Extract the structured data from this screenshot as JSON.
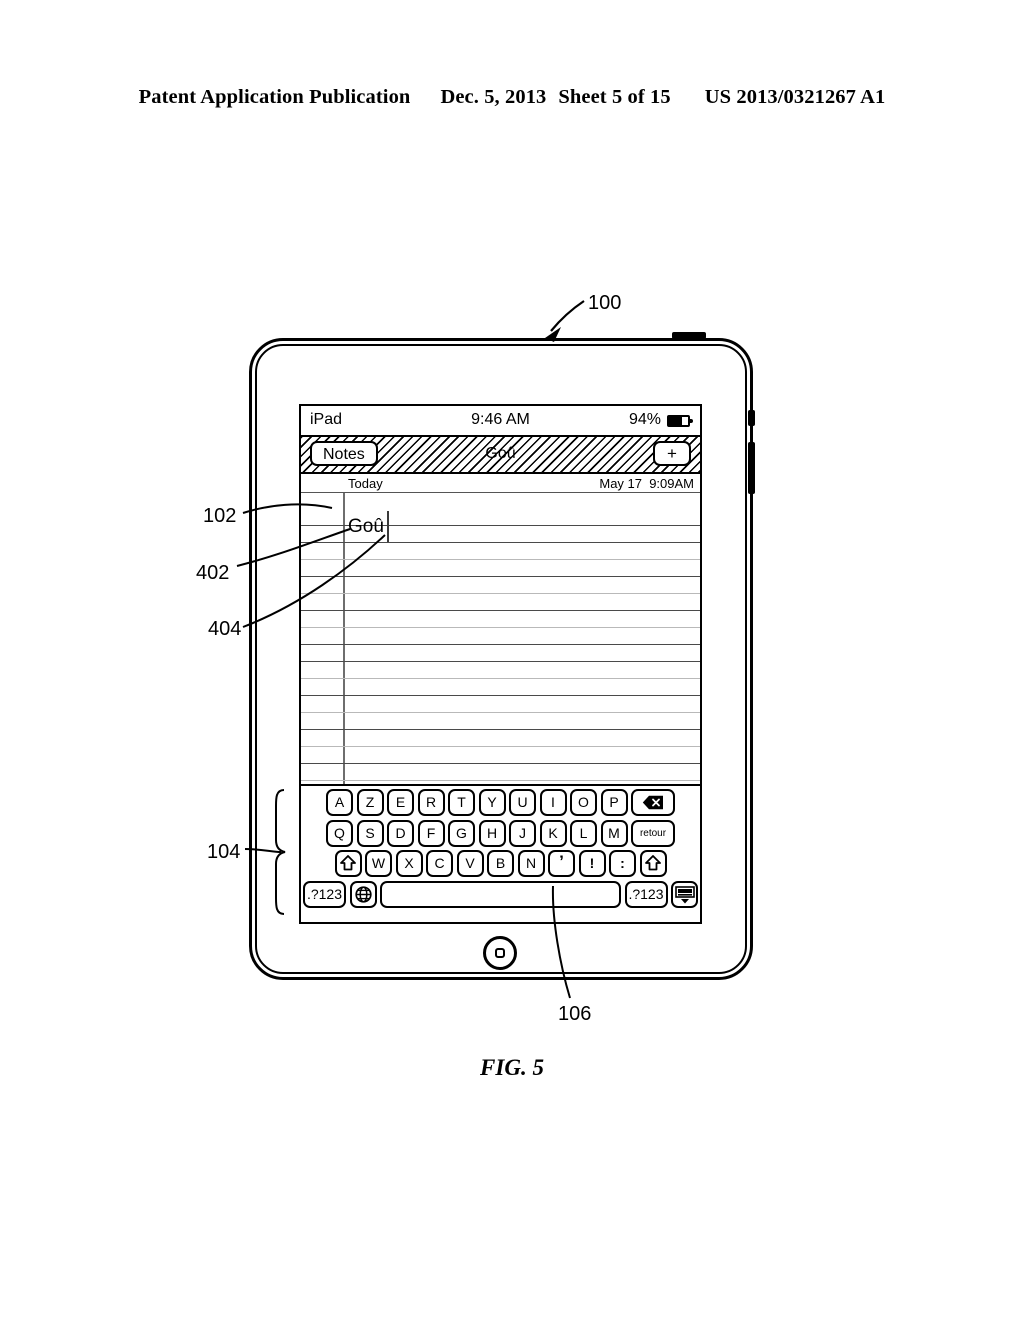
{
  "patent_header": {
    "publication": "Patent Application Publication",
    "date": "Dec. 5, 2013",
    "sheet": "Sheet 5 of 15",
    "number": "US 2013/0321267 A1"
  },
  "figure": {
    "caption": "FIG. 5"
  },
  "reference_numerals": {
    "device": "100",
    "display": "102",
    "keyboard": "104",
    "apostrophe_key": "106",
    "note_text_ref": "402",
    "caret_ref": "404"
  },
  "device": {
    "status_bar": {
      "device_name": "iPad",
      "time": "9:46 AM",
      "battery_percent": "94%",
      "battery_icon": "battery-icon"
    },
    "nav_bar": {
      "back_label": "Notes",
      "title": "Goû",
      "add_label": "+"
    },
    "note": {
      "day_label": "Today",
      "date": "May 17",
      "time": "9:09AM",
      "body_text": "Goû"
    },
    "keyboard": {
      "layout_name": "AZERTY",
      "rows": [
        [
          {
            "label": "A",
            "name": "key-a"
          },
          {
            "label": "Z",
            "name": "key-z"
          },
          {
            "label": "E",
            "name": "key-e"
          },
          {
            "label": "R",
            "name": "key-r"
          },
          {
            "label": "T",
            "name": "key-t"
          },
          {
            "label": "Y",
            "name": "key-y"
          },
          {
            "label": "U",
            "name": "key-u"
          },
          {
            "label": "I",
            "name": "key-i"
          },
          {
            "label": "O",
            "name": "key-o"
          },
          {
            "label": "P",
            "name": "key-p"
          },
          {
            "label": "",
            "name": "key-backspace",
            "icon": "backspace-icon"
          }
        ],
        [
          {
            "label": "Q",
            "name": "key-q"
          },
          {
            "label": "S",
            "name": "key-s"
          },
          {
            "label": "D",
            "name": "key-d"
          },
          {
            "label": "F",
            "name": "key-f"
          },
          {
            "label": "G",
            "name": "key-g"
          },
          {
            "label": "H",
            "name": "key-h"
          },
          {
            "label": "J",
            "name": "key-j"
          },
          {
            "label": "K",
            "name": "key-k"
          },
          {
            "label": "L",
            "name": "key-l"
          },
          {
            "label": "M",
            "name": "key-m"
          },
          {
            "label": "retour",
            "name": "key-return"
          }
        ],
        [
          {
            "label": "",
            "name": "key-shift-left",
            "icon": "shift-icon"
          },
          {
            "label": "W",
            "name": "key-w"
          },
          {
            "label": "X",
            "name": "key-x"
          },
          {
            "label": "C",
            "name": "key-c"
          },
          {
            "label": "V",
            "name": "key-v"
          },
          {
            "label": "B",
            "name": "key-b"
          },
          {
            "label": "N",
            "name": "key-n"
          },
          {
            "label": "’",
            "name": "key-apostrophe"
          },
          {
            "label": "!",
            "name": "key-exclamation"
          },
          {
            "label": ":",
            "name": "key-colon"
          },
          {
            "label": "",
            "name": "key-shift-right",
            "icon": "shift-icon"
          }
        ],
        [
          {
            "label": ".?123",
            "name": "key-numbers-left"
          },
          {
            "label": "",
            "name": "key-globe",
            "icon": "globe-icon"
          },
          {
            "label": "",
            "name": "key-space"
          },
          {
            "label": ".?123",
            "name": "key-numbers-right"
          },
          {
            "label": "",
            "name": "key-dismiss-keyboard",
            "icon": "keyboard-dismiss-icon"
          }
        ]
      ]
    }
  }
}
